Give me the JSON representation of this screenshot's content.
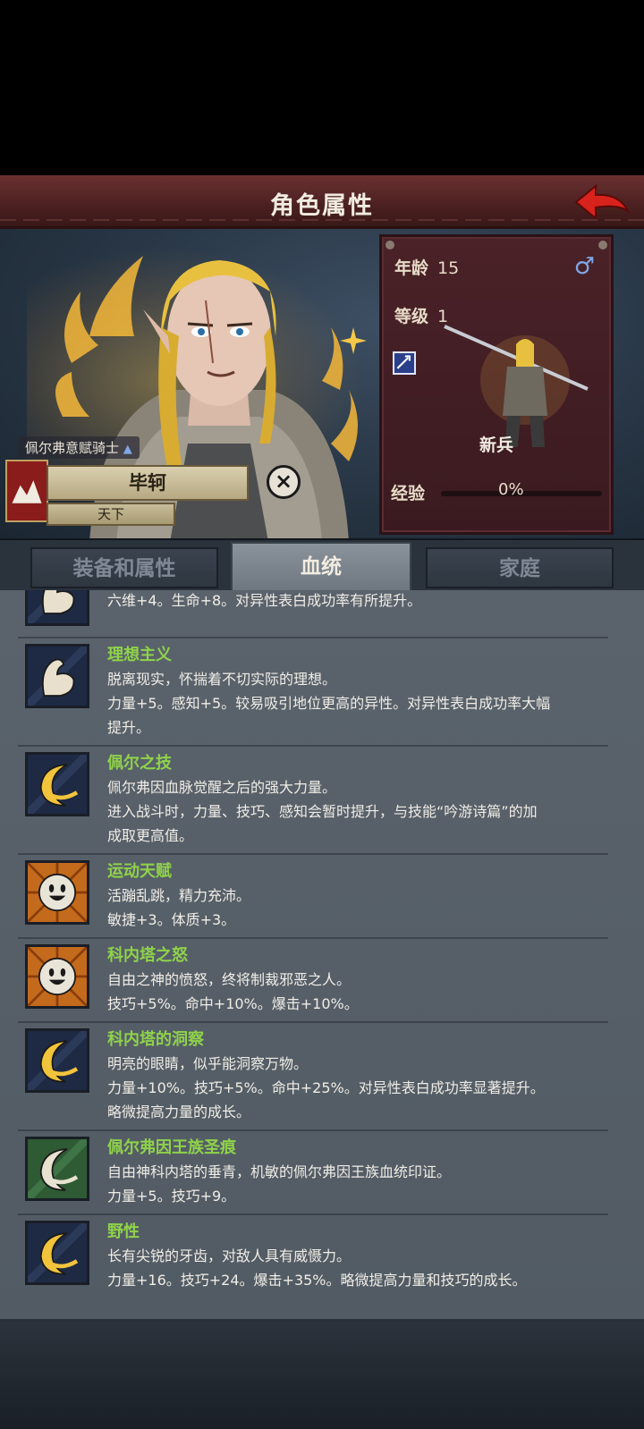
{
  "header": {
    "title": "角色属性"
  },
  "character": {
    "age_label": "年龄",
    "age_value": "15",
    "gender_icon": "male-icon",
    "level_label": "等级",
    "level_value": "1",
    "rank": "新兵",
    "exp_label": "经验",
    "exp_value": "0%",
    "exp_fraction": 0,
    "title": "佩尔弗意赋骑士",
    "name": "毕轲",
    "faction": "天下"
  },
  "tabs": [
    {
      "label": "装备和属性",
      "active": false
    },
    {
      "label": "血统",
      "active": true
    },
    {
      "label": "家庭",
      "active": false
    }
  ],
  "traits": [
    {
      "name": "",
      "icon": "arm-icon",
      "lines": [
        "六维+4。生命+8。对异性表白成功率有所提升。"
      ]
    },
    {
      "name": "理想主义",
      "icon": "arm-icon",
      "lines": [
        "脱离现实，怀揣着不切实际的理想。",
        "力量+5。感知+5。较易吸引地位更高的异性。对异性表白成功率大幅",
        "提升。"
      ]
    },
    {
      "name": "佩尔之技",
      "icon": "moon-icon",
      "lines": [
        "佩尔弗因血脉觉醒之后的强大力量。",
        "进入战斗时，力量、技巧、感知会暂时提升，与技能“吟游诗篇”的加",
        "成取更高值。"
      ]
    },
    {
      "name": "运动天赋",
      "icon": "smile-icon",
      "lines": [
        "活蹦乱跳，精力充沛。",
        "敏捷+3。体质+3。"
      ]
    },
    {
      "name": "科内塔之怒",
      "icon": "smile-icon",
      "lines": [
        "自由之神的愤怒，终将制裁邪恶之人。",
        "技巧+5%。命中+10%。爆击+10%。"
      ]
    },
    {
      "name": "科内塔的洞察",
      "icon": "moon-icon",
      "lines": [
        "明亮的眼睛，似乎能洞察万物。",
        "力量+10%。技巧+5%。命中+25%。对异性表白成功率显著提升。",
        "略微提高力量的成长。"
      ]
    },
    {
      "name": "佩尔弗因王族圣痕",
      "icon": "green-moon-icon",
      "lines": [
        "自由神科内塔的垂青，机敏的佩尔弗因王族血统印证。",
        "力量+5。技巧+9。"
      ]
    },
    {
      "name": "野性",
      "icon": "moon-icon",
      "lines": [
        "长有尖锐的牙齿，对敌人具有威慑力。",
        "力量+16。技巧+24。爆击+35%。略微提高力量和技巧的成长。"
      ]
    }
  ]
}
